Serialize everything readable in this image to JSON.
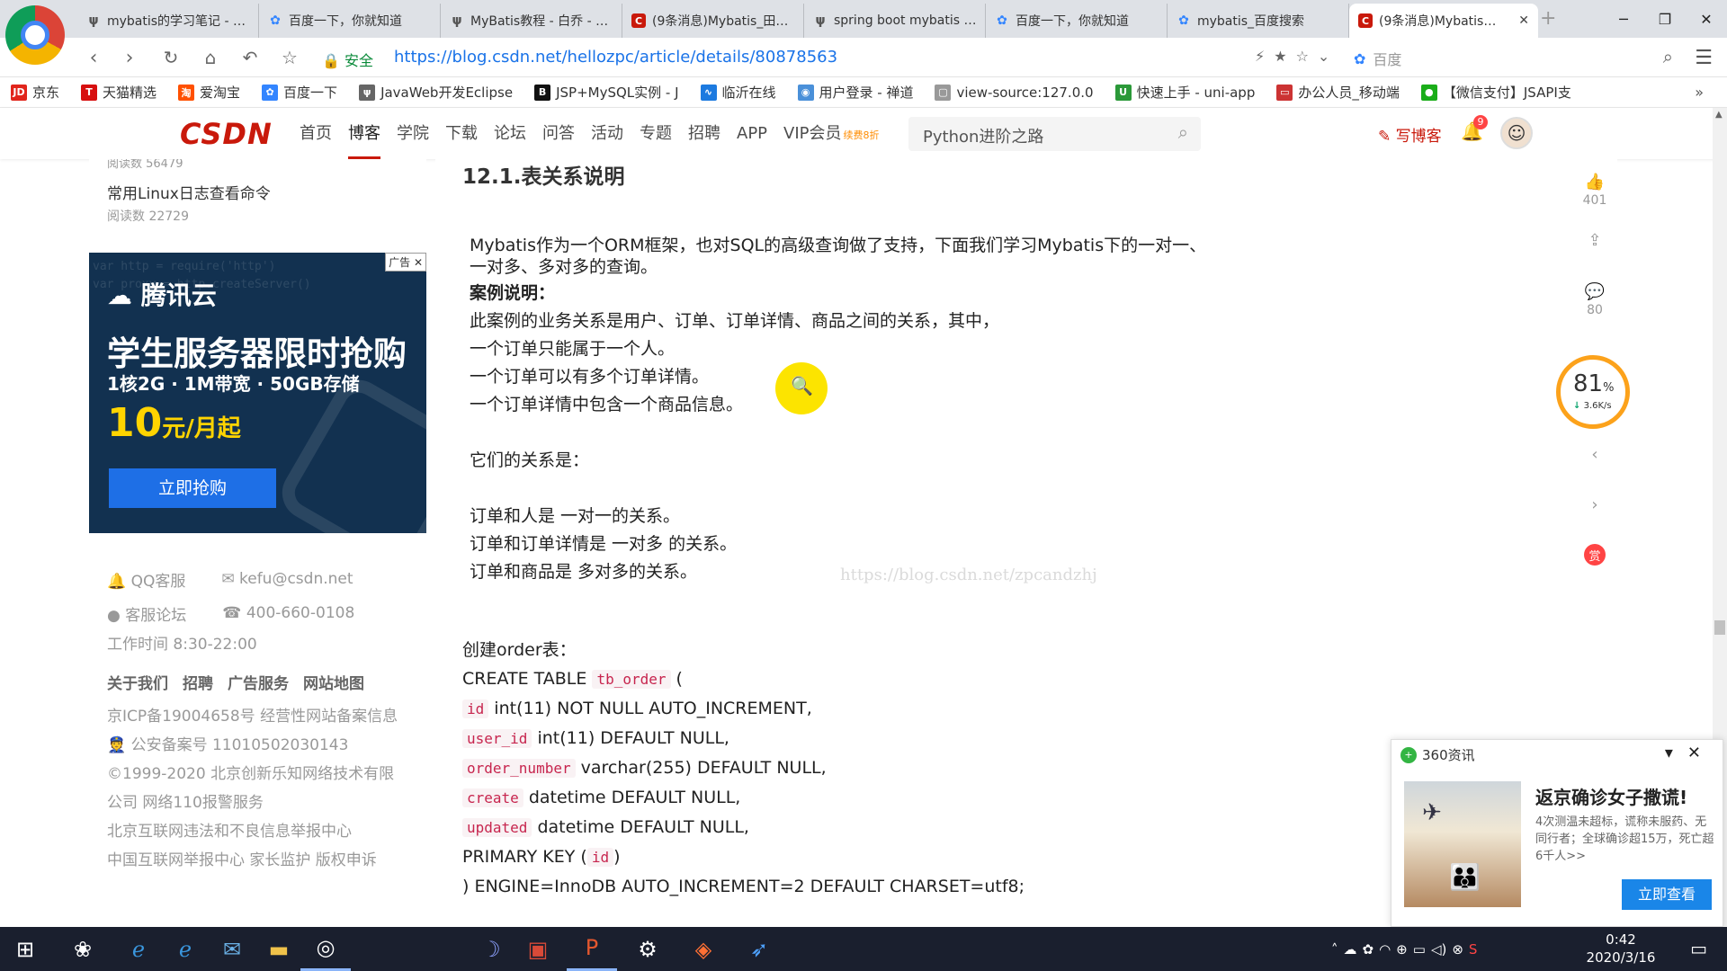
{
  "browser": {
    "tabs": [
      {
        "title": "mybatis的学习笔记 - …",
        "icon": "bird"
      },
      {
        "title": "百度一下，你就知道",
        "icon": "paw"
      },
      {
        "title": "MyBatis教程 - 白乔 - …",
        "icon": "bird"
      },
      {
        "title": "(9条消息)Mybatis_田…",
        "icon": "csdn"
      },
      {
        "title": "spring boot mybatis …",
        "icon": "bird"
      },
      {
        "title": "百度一下，你就知道",
        "icon": "paw"
      },
      {
        "title": "mybatis_百度搜索",
        "icon": "paw"
      },
      {
        "title": "(9条消息)Mybatis…",
        "icon": "csdn",
        "active": true
      }
    ],
    "security_label": "安全",
    "url": "https://blog.csdn.net/hellozpc/article/details/80878563",
    "search_engine_placeholder": "百度",
    "bookmarks": [
      {
        "label": "京东",
        "icon_text": "JD",
        "color": "#e1251b"
      },
      {
        "label": "天猫精选",
        "icon_text": "T",
        "color": "#d70f0f"
      },
      {
        "label": "爱淘宝",
        "icon_text": "淘",
        "color": "#ff5000"
      },
      {
        "label": "百度一下",
        "icon_text": "✿",
        "color": "#3385ff"
      },
      {
        "label": "JavaWeb开发Eclipse",
        "icon_text": "ψ",
        "color": "#666666"
      },
      {
        "label": "JSP+MySQL实例 - J",
        "icon_text": "B",
        "color": "#111111"
      },
      {
        "label": "临沂在线",
        "icon_text": "∿",
        "color": "#1c7ae0"
      },
      {
        "label": "用户登录 - 禅道",
        "icon_text": "◉",
        "color": "#4a90d9"
      },
      {
        "label": "view-source:127.0.0",
        "icon_text": "▢",
        "color": "#999999"
      },
      {
        "label": "快速上手 - uni-app",
        "icon_text": "U",
        "color": "#2b9939"
      },
      {
        "label": "办公人员_移动端",
        "icon_text": "▭",
        "color": "#cc3333"
      },
      {
        "label": "【微信支付】JSAPI支",
        "icon_text": "●",
        "color": "#1aad19"
      }
    ]
  },
  "nav": {
    "logo": "CSDN",
    "items": [
      "首页",
      "博客",
      "学院",
      "下载",
      "论坛",
      "问答",
      "活动",
      "专题",
      "招聘",
      "APP",
      "VIP会员"
    ],
    "active_index": 1,
    "vip_tag": "续费8折",
    "search_value": "Python进阶之路",
    "write_label": "写博客",
    "notification_count": "9"
  },
  "sidebar": {
    "cut_text": "阅读数 56479",
    "article_title": "常用Linux日志查看命令",
    "article_reads": "阅读数 22729",
    "ad": {
      "badge": "广告",
      "brand": "腾讯云",
      "headline": "学生服务器限时抢购",
      "spec": "1核2G · 1M带宽 · 50GB存储",
      "price": "10",
      "price_unit": "元/月起",
      "cta": "立即抢购"
    },
    "footer": {
      "qq": "QQ客服",
      "email": "kefu@csdn.net",
      "forum": "客服论坛",
      "phone": "400-660-0108",
      "hours": "工作时间 8:30-22:00",
      "links": [
        "关于我们",
        "招聘",
        "广告服务",
        "网站地图"
      ],
      "icp": "京ICP备19004658号   经营性网站备案信息",
      "police": "公安备案号 11010502030143",
      "copyright": "©1999-2020 北京创新乐知网络技术有限",
      "copyright2": "公司    网络110报警服务",
      "report1": "北京互联网违法和不良信息举报中心",
      "report2": "中国互联网举报中心  家长监护  版权申诉"
    }
  },
  "article": {
    "heading": "12.1.表关系说明",
    "intro": "Mybatis作为一个ORM框架，也对SQL的高级查询做了支持，下面我们学习Mybatis下的一对一、一对多、多对多的查询。",
    "case_label": "案例说明：",
    "case_lines": [
      "此案例的业务关系是用户、订单、订单详情、商品之间的关系，其中，",
      "一个订单只能属于一个人。",
      "一个订单可以有多个订单详情。",
      "一个订单详情中包含一个商品信息。"
    ],
    "relation_label": "它们的关系是：",
    "relation_lines": [
      "订单和人是 一对一的关系。",
      "订单和订单详情是 一对多 的关系。",
      "订单和商品是 多对多的关系。"
    ],
    "watermark": "https://blog.csdn.net/zpcandzhj",
    "sql_intro": "创建order表：",
    "sql": {
      "line1_pre": "CREATE TABLE ",
      "table": "tb_order",
      "line1_post": " (",
      "cols": [
        {
          "name": "id",
          "def": " int(11) NOT NULL AUTO_INCREMENT,"
        },
        {
          "name": "user_id",
          "def": " int(11) DEFAULT NULL,"
        },
        {
          "name": "order_number",
          "def": " varchar(255) DEFAULT NULL,"
        },
        {
          "name": "create",
          "def": " datetime DEFAULT NULL,"
        },
        {
          "name": "updated",
          "def": " datetime DEFAULT NULL,"
        }
      ],
      "pk_pre": "PRIMARY KEY (",
      "pk": "id",
      "pk_post": ")",
      "end": ") ENGINE=InnoDB AUTO_INCREMENT=2 DEFAULT CHARSET=utf8;"
    }
  },
  "tools": {
    "like_count": "401",
    "comment_count": "80"
  },
  "speed": {
    "percent": "81",
    "percent_unit": "%",
    "rate": "3.6K/s"
  },
  "news": {
    "source": "360资讯",
    "title": "返京确诊女子撒谎!",
    "desc": "4次测温未超标，谎称未服药、无同行者；全球确诊超15万，死亡超6千人>>",
    "button": "立即查看"
  },
  "taskbar": {
    "time": "0:42",
    "date": "2020/3/16"
  }
}
